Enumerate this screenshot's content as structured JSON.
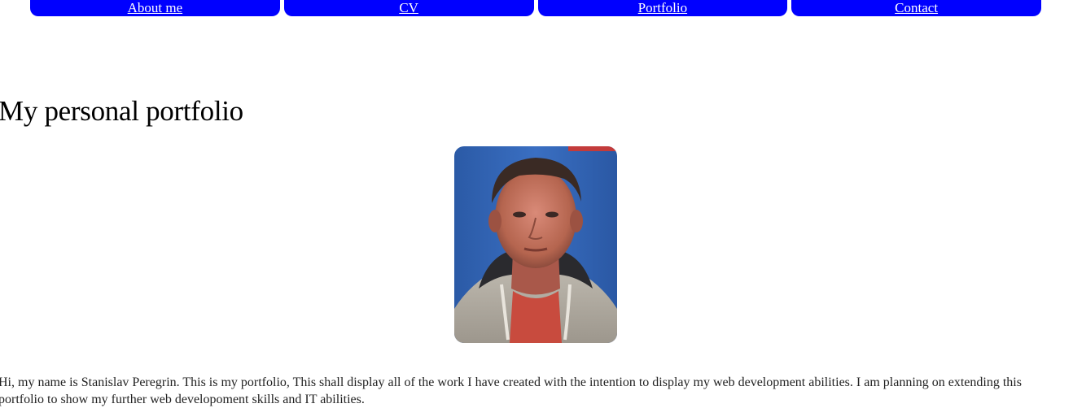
{
  "nav": {
    "items": [
      {
        "label": "About me"
      },
      {
        "label": "CV"
      },
      {
        "label": "Portfolio"
      },
      {
        "label": "Contact"
      }
    ]
  },
  "main": {
    "title": "My personal portfolio",
    "photo_alt": "portrait-photo",
    "intro": "Hi, my name is Stanislav Peregrin. This is my portfolio, This shall display all of the work I have created with the intention to display my web development abilities. I am planning on extending this portfolio to show my further web developoment skills and IT abilities."
  },
  "colors": {
    "nav_bg": "#0000ff",
    "nav_text": "#ffffff",
    "photo_bg": "#2f5fa8"
  }
}
